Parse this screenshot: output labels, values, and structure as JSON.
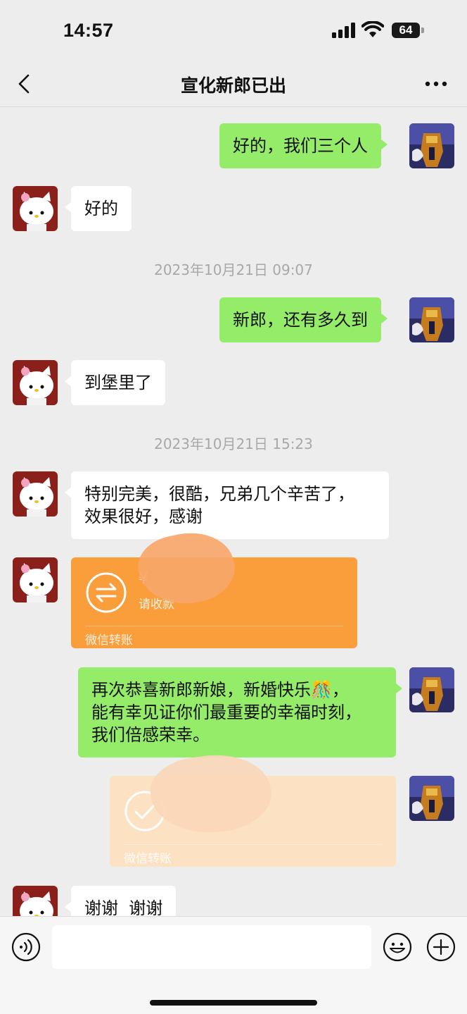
{
  "status_bar": {
    "time": "14:57",
    "battery": "64"
  },
  "header": {
    "title": "宣化新郎已出"
  },
  "messages": [
    {
      "text": "好的，我们三个人"
    },
    {
      "text": "好的"
    },
    {
      "text": "2023年10月21日 09:07"
    },
    {
      "text": "新郎，还有多久到"
    },
    {
      "text": "到堡里了"
    },
    {
      "text": "2023年10月21日 15:23"
    },
    {
      "text": "特别完美，很酷，兄弟几个辛苦了，\n效果很好，感谢"
    },
    {
      "amount": "¥",
      "status": "请收款",
      "footer": "微信转账"
    },
    {
      "text": "再次恭喜新郎新娘，新婚快乐🎊，\n能有幸见证你们最重要的幸福时刻，\n我们倍感荣幸。"
    },
    {
      "status": "已",
      "footer": "微信转账"
    },
    {
      "text": "谢谢  谢谢"
    }
  ],
  "input_bar": {
    "placeholder": ""
  },
  "colors": {
    "my_bubble": "#95ec69",
    "transfer_pending": "#fa9d3b",
    "transfer_done": "#fde1c3",
    "background": "#ededed"
  }
}
